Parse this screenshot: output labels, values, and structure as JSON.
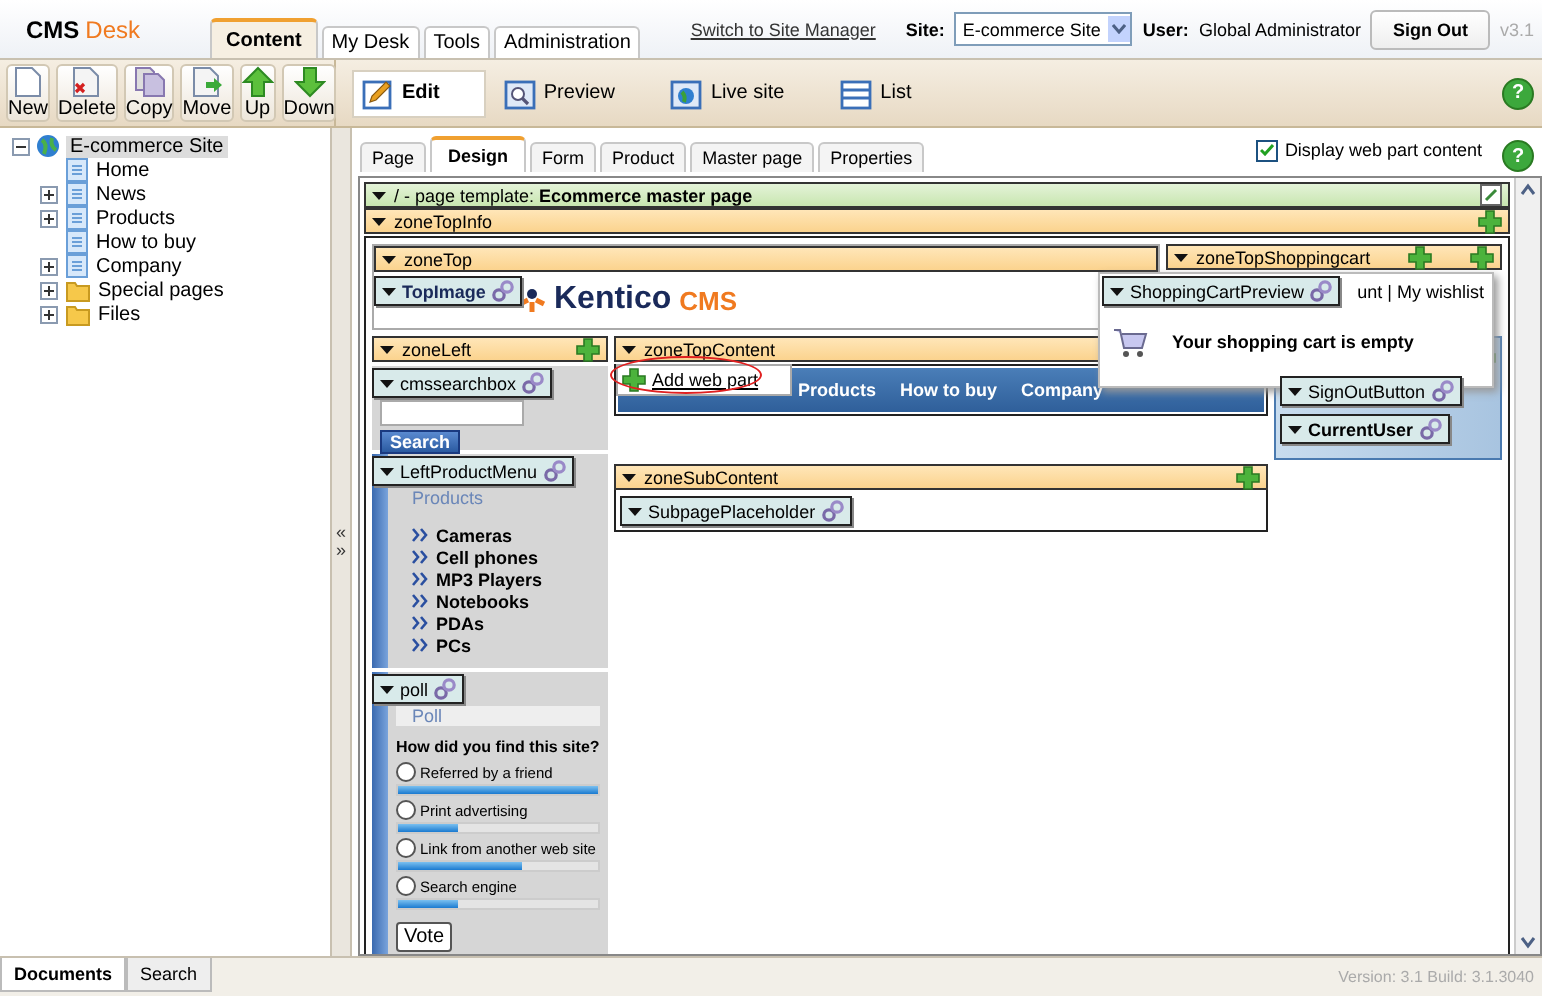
{
  "header": {
    "logo_bold": "CMS",
    "logo_accent": "Desk",
    "tabs": [
      {
        "label": "Content",
        "selected": true
      },
      {
        "label": "My Desk",
        "selected": false
      },
      {
        "label": "Tools",
        "selected": false
      },
      {
        "label": "Administration",
        "selected": false
      }
    ],
    "switch_link": "Switch to Site Manager",
    "site_label": "Site:",
    "site_value": "E-commerce Site",
    "user_label": "User:",
    "user_name": "Global Administrator",
    "sign_out": "Sign Out",
    "version": "v3.1"
  },
  "toolbar": {
    "actions": [
      {
        "label": "New",
        "kind": "new"
      },
      {
        "label": "Delete",
        "kind": "delete"
      },
      {
        "label": "Copy",
        "kind": "copy"
      },
      {
        "label": "Move",
        "kind": "move"
      },
      {
        "label": "Up",
        "kind": "up"
      },
      {
        "label": "Down",
        "kind": "down"
      }
    ],
    "views": [
      {
        "label": "Edit",
        "kind": "edit",
        "selected": true
      },
      {
        "label": "Preview",
        "kind": "preview",
        "selected": false
      },
      {
        "label": "Live site",
        "kind": "live",
        "selected": false
      },
      {
        "label": "List",
        "kind": "list",
        "selected": false
      }
    ],
    "help": "?"
  },
  "tree": {
    "label": "E-commerce Site",
    "selected": true,
    "expanded": true,
    "children": [
      {
        "label": "Home",
        "kind": "page",
        "expander": false
      },
      {
        "label": "News",
        "kind": "page",
        "expander": true
      },
      {
        "label": "Products",
        "kind": "page",
        "expander": true
      },
      {
        "label": "How to buy",
        "kind": "page",
        "expander": false
      },
      {
        "label": "Company",
        "kind": "page",
        "expander": true
      },
      {
        "label": "Special pages",
        "kind": "folder",
        "expander": true
      },
      {
        "label": "Files",
        "kind": "folder",
        "expander": true
      }
    ]
  },
  "splitter": {
    "collapse": "«",
    "expand": "»"
  },
  "content_tabs": [
    {
      "label": "Page",
      "selected": false
    },
    {
      "label": "Design",
      "selected": true
    },
    {
      "label": "Form",
      "selected": false
    },
    {
      "label": "Product",
      "selected": false
    },
    {
      "label": "Master page",
      "selected": false
    },
    {
      "label": "Properties",
      "selected": false
    }
  ],
  "display_web_part_content": {
    "label": "Display web part content",
    "checked": true
  },
  "help": "?",
  "design": {
    "template_bar": "/ - page template: **Ecommerce master page**",
    "zone_top_info": "zoneTopInfo",
    "zone_top": {
      "title": "zoneTop",
      "web_part": "TopImage",
      "logo_text": "Kentico",
      "logo_accent": "CMS"
    },
    "zone_top_cart": {
      "title": "zoneTopShoppingcart",
      "web_part": "ShoppingCartPreview",
      "links": "unt | My wishlist",
      "message": "Your shopping cart is empty"
    },
    "zone_left": {
      "title": "zoneLeft",
      "search_part": "cmssearchbox",
      "search_button": "Search",
      "menu_part": "LeftProductMenu",
      "menu_title": "Products",
      "menu_items": [
        "Cameras",
        "Cell phones",
        "MP3 Players",
        "Notebooks",
        "PDAs",
        "PCs"
      ],
      "poll_part": "poll",
      "poll_title": "Poll",
      "poll_question": "How did you find this site?",
      "poll_options": [
        {
          "label": "Referred by a friend",
          "selected": false,
          "level": 1
        },
        {
          "label": "Print advertising",
          "selected": false,
          "level": 0.3
        },
        {
          "label": "Link from another web site",
          "selected": false,
          "level": 0.62
        },
        {
          "label": "Search engine",
          "selected": false,
          "level": 0.3
        }
      ],
      "vote": "Vote"
    },
    "zone_top_content": {
      "title": "zoneTopContent",
      "add_web_part": "Add web part",
      "menu_items": [
        "Products",
        "How to buy",
        "Company"
      ]
    },
    "right_parts": [
      "SignOutButton",
      "CurrentUser"
    ],
    "zone_sub_content": {
      "title": "zoneSubContent",
      "web_part": "SubpagePlaceholder"
    }
  },
  "bottom_tabs": [
    {
      "label": "Documents",
      "selected": true
    },
    {
      "label": "Search",
      "selected": false
    }
  ],
  "version_info": "Version: 3.1 Build: 3.1.3040"
}
